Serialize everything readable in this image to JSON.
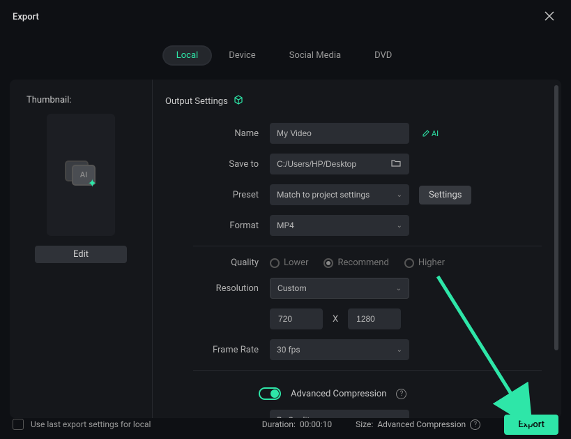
{
  "header": {
    "title": "Export"
  },
  "tabs": {
    "local": "Local",
    "device": "Device",
    "social": "Social Media",
    "dvd": "DVD"
  },
  "leftPanel": {
    "thumbnailLabel": "Thumbnail:",
    "editLabel": "Edit"
  },
  "outputSettings": {
    "header": "Output Settings",
    "name": {
      "label": "Name",
      "value": "My Video",
      "aiTag": "AI"
    },
    "saveTo": {
      "label": "Save to",
      "value": "C:/Users/HP/Desktop"
    },
    "preset": {
      "label": "Preset",
      "value": "Match to project settings",
      "settingsLabel": "Settings"
    },
    "format": {
      "label": "Format",
      "value": "MP4"
    },
    "quality": {
      "label": "Quality",
      "lower": "Lower",
      "recommend": "Recommend",
      "higher": "Higher"
    },
    "resolution": {
      "label": "Resolution",
      "value": "Custom",
      "width": "720",
      "separator": "X",
      "height": "1280"
    },
    "frameRate": {
      "label": "Frame Rate",
      "value": "30 fps"
    },
    "compression": {
      "label": "Advanced Compression",
      "mode": "By Quality"
    }
  },
  "footer": {
    "checkboxLabel": "Use last export settings for local",
    "durationLabel": "Duration:",
    "durationValue": "00:00:10",
    "sizeLabel": "Size:",
    "sizeValue": "Advanced Compression",
    "exportLabel": "Export"
  }
}
